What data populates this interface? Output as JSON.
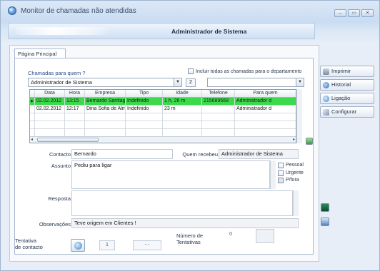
{
  "window": {
    "title": "Monitor de chamadas não atendidas",
    "controls": [
      "–",
      "▭",
      "✕"
    ]
  },
  "banner": {
    "title": "Administrador de Sistema"
  },
  "tabs": [
    {
      "label": "Página Principal",
      "active": true
    }
  ],
  "filter": {
    "link_label": "Chamadas para quem ?",
    "who_value": "Administrador de Sistema",
    "include_all_label": "Incluir todas as chamadas para o departamento",
    "count": "2",
    "department_value": ""
  },
  "grid": {
    "columns": [
      "Data",
      "Hora",
      "Empresa",
      "Tipo",
      "Idade",
      "Telefone",
      "Para quem"
    ],
    "rows": [
      {
        "indicator": "▶",
        "cells": [
          "02.02.2012",
          "13:15",
          "Bernardo Santiago",
          "Indefinido",
          "1 h, 26 m",
          "215689568",
          "Administrador d"
        ],
        "selected": true
      },
      {
        "indicator": "",
        "cells": [
          "02.02.2012",
          "12:17",
          "Dina Sofia de Alme",
          "Indefinido",
          "23 m",
          "",
          "Administrador d"
        ],
        "selected": false
      },
      {
        "indicator": "",
        "cells": [
          "",
          "",
          "",
          "",
          "",
          "",
          ""
        ],
        "selected": false
      },
      {
        "indicator": "",
        "cells": [
          "",
          "",
          "",
          "",
          "",
          "",
          ""
        ],
        "selected": false
      },
      {
        "indicator": "",
        "cells": [
          "",
          "",
          "",
          "",
          "",
          "",
          ""
        ],
        "selected": false
      }
    ],
    "scroll_left": "◂",
    "scroll_right": "▸"
  },
  "side_buttons": [
    {
      "label": "Imprimir",
      "icon": "printer-icon"
    },
    {
      "label": "Historial",
      "icon": "history-icon"
    },
    {
      "label": "Ligação",
      "icon": "phone-icon"
    },
    {
      "label": "Configurar",
      "icon": "settings-icon"
    }
  ],
  "details": {
    "contact_label": "Contacto",
    "contact_value": "Bernardo",
    "received_label": "Quem recebeu",
    "received_value": "Administrador de Sistema",
    "subject_label": "Assunto",
    "subject_value": "Pediu para ligar",
    "response_label": "Resposta",
    "response_value": "",
    "notes_label": "Observações",
    "notes_value": "Teve origem em Clientes !",
    "flags": [
      {
        "label": "Pessoal",
        "checked": false
      },
      {
        "label": "Urgente",
        "checked": false
      },
      {
        "label": "P/fora",
        "checked": true
      }
    ]
  },
  "footer": {
    "attempt_label_1": "Tentativa",
    "attempt_label_2": "de contacto",
    "attempt_value": "1",
    "attempt_extra": "- -",
    "count_label_1": "Número de",
    "count_label_2": "Tentativas",
    "count_value": "0"
  },
  "colors": {
    "selected_row": "#3cd94a",
    "link": "#2e4f8f"
  }
}
